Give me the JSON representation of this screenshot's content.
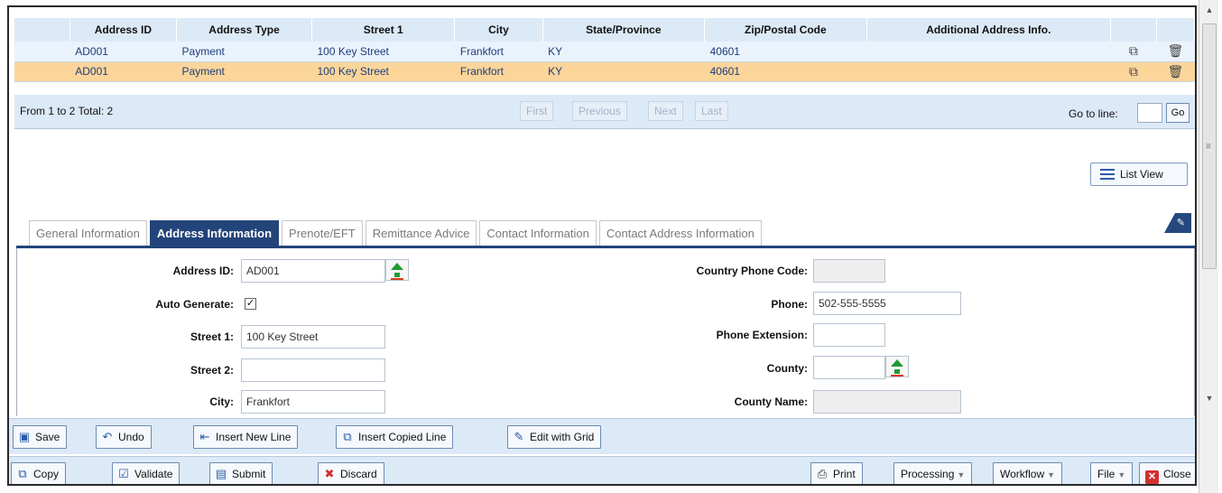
{
  "grid": {
    "columns": [
      "",
      "Address ID",
      "Address Type",
      "Street 1",
      "City",
      "State/Province",
      "Zip/Postal Code",
      "Additional Address Info.",
      "",
      ""
    ],
    "rows": [
      {
        "address_id": "AD001",
        "address_type": "Payment",
        "street1": "100 Key Street",
        "city": "Frankfort",
        "state": "KY",
        "zip": "40601",
        "info": ""
      },
      {
        "address_id": "AD001",
        "address_type": "Payment",
        "street1": "100 Key Street",
        "city": "Frankfort",
        "state": "KY",
        "zip": "40601",
        "info": ""
      }
    ],
    "icons": {
      "copy": "copy-icon",
      "delete": "trash-icon"
    },
    "selected_row_color": "#fbd59a"
  },
  "pager": {
    "total": "From 1 to 2 Total: 2",
    "first": "First",
    "previous": "Previous",
    "next": "Next",
    "last": "Last",
    "goto_label": "Go to line:",
    "goto_value": "",
    "go": "Go"
  },
  "list_view": "List View",
  "tabs": [
    {
      "label": "General Information",
      "active": false
    },
    {
      "label": "Address Information",
      "active": true
    },
    {
      "label": "Prenote/EFT",
      "active": false
    },
    {
      "label": "Remittance Advice",
      "active": false
    },
    {
      "label": "Contact Information",
      "active": false
    },
    {
      "label": "Contact Address Information",
      "active": false
    }
  ],
  "form": {
    "address_id_label": "Address ID:",
    "address_id": "AD001",
    "auto_generate_label": "Auto Generate:",
    "auto_generate_mark": "✓",
    "street1_label": "Street 1:",
    "street1": "100 Key Street",
    "street2_label": "Street 2:",
    "street2": "",
    "city_label": "City:",
    "city": "Frankfort",
    "country_phone_code_label": "Country Phone Code:",
    "country_phone_code": "",
    "phone_label": "Phone:",
    "phone": "502-555-5555",
    "phone_ext_label": "Phone Extension:",
    "phone_ext": "",
    "county_label": "County:",
    "county": "",
    "county_name_label": "County Name:",
    "county_name": ""
  },
  "toolbar1": {
    "save": "Save",
    "undo": "Undo",
    "insert_new_line": "Insert New Line",
    "insert_copied_line": "Insert Copied Line",
    "edit_with_grid": "Edit with Grid"
  },
  "toolbar2": {
    "copy": "Copy",
    "validate": "Validate",
    "submit": "Submit",
    "discard": "Discard",
    "print": "Print",
    "processing": "Processing",
    "workflow": "Workflow",
    "file": "File",
    "close": "Close"
  },
  "colors": {
    "header_bg": "#dce9f7",
    "active_tab": "#22447a",
    "accent_blue": "#2a5ca8"
  }
}
